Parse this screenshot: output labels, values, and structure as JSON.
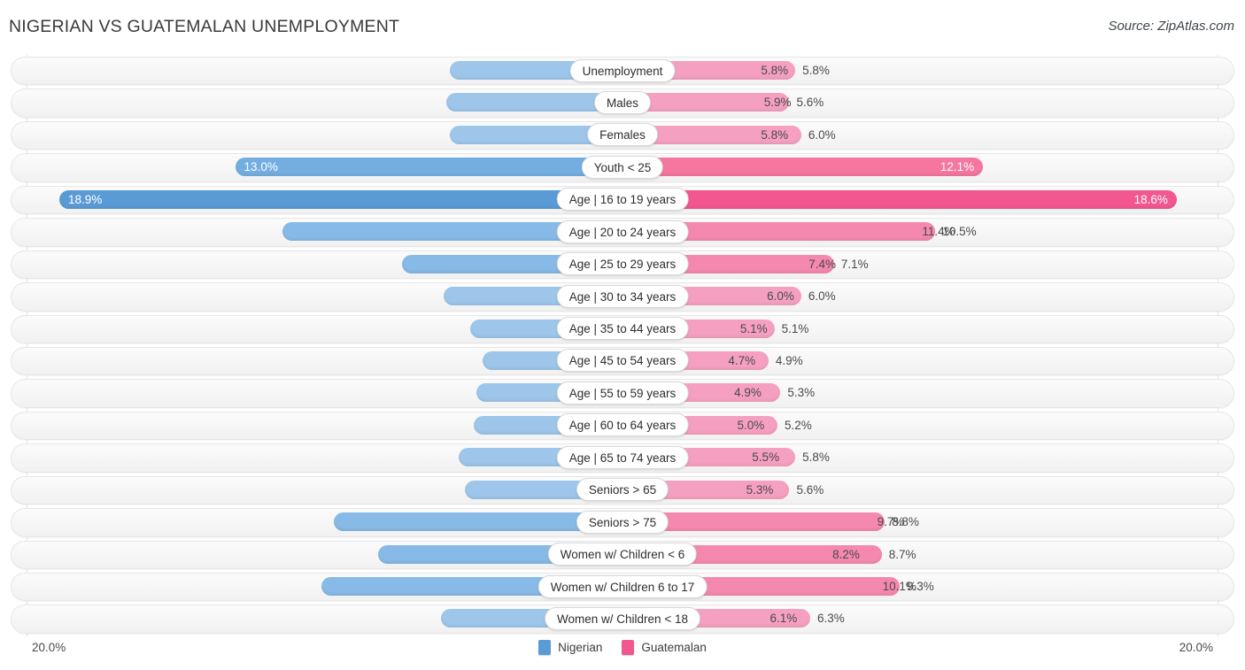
{
  "header": {
    "title": "NIGERIAN VS GUATEMALAN UNEMPLOYMENT",
    "source": "Source: ZipAtlas.com"
  },
  "footer": {
    "axis_min_label": "20.0%",
    "axis_max_label": "20.0%",
    "legend": [
      {
        "label": "Nigerian",
        "color": "#5b9bd5"
      },
      {
        "label": "Guatemalan",
        "color": "#f2578f"
      }
    ]
  },
  "colors": {
    "nigerian_light": "#9dc6ea",
    "nigerian_mid": "#87bae6",
    "nigerian_strong": "#74aee0",
    "nigerian_max": "#5b9bd5",
    "guatemalan_light": "#f5a0c0",
    "guatemalan_mid": "#f588ae",
    "guatemalan_strong": "#f5769f",
    "guatemalan_max": "#f2578f",
    "track": "#f6f6f6",
    "gridline": "#e2e2e2"
  },
  "chart_data": {
    "type": "bar",
    "subtype": "diverging-bidirectional",
    "title": "NIGERIAN VS GUATEMALAN UNEMPLOYMENT",
    "xlabel": "",
    "ylabel": "",
    "axis_max": 20.0,
    "axis_unit": "%",
    "grid": true,
    "legend_position": "bottom-center",
    "categories": [
      "Unemployment",
      "Males",
      "Females",
      "Youth < 25",
      "Age | 16 to 19 years",
      "Age | 20 to 24 years",
      "Age | 25 to 29 years",
      "Age | 30 to 34 years",
      "Age | 35 to 44 years",
      "Age | 45 to 54 years",
      "Age | 55 to 59 years",
      "Age | 60 to 64 years",
      "Age | 65 to 74 years",
      "Seniors > 65",
      "Seniors > 75",
      "Women w/ Children < 6",
      "Women w/ Children 6 to 17",
      "Women w/ Children < 18"
    ],
    "series": [
      {
        "name": "Nigerian",
        "side": "left",
        "color": "#9dc6ea",
        "values": [
          5.8,
          5.9,
          5.8,
          13.0,
          18.9,
          11.4,
          7.4,
          6.0,
          5.1,
          4.7,
          4.9,
          5.0,
          5.5,
          5.3,
          9.7,
          8.2,
          10.1,
          6.1
        ],
        "labels": [
          "5.8%",
          "5.9%",
          "5.8%",
          "13.0%",
          "18.9%",
          "11.4%",
          "7.4%",
          "6.0%",
          "5.1%",
          "4.7%",
          "4.9%",
          "5.0%",
          "5.5%",
          "5.3%",
          "9.7%",
          "8.2%",
          "10.1%",
          "6.1%"
        ]
      },
      {
        "name": "Guatemalan",
        "side": "right",
        "color": "#f5a0c0",
        "values": [
          5.8,
          5.6,
          6.0,
          12.1,
          18.6,
          10.5,
          7.1,
          6.0,
          5.1,
          4.9,
          5.3,
          5.2,
          5.8,
          5.6,
          8.8,
          8.7,
          9.3,
          6.3
        ],
        "labels": [
          "5.8%",
          "5.6%",
          "6.0%",
          "12.1%",
          "18.6%",
          "10.5%",
          "7.1%",
          "6.0%",
          "5.1%",
          "4.9%",
          "5.3%",
          "5.2%",
          "5.8%",
          "5.6%",
          "8.8%",
          "8.7%",
          "9.3%",
          "6.3%"
        ]
      }
    ],
    "rows": [
      {
        "label": "Unemployment",
        "left": 5.8,
        "right": 5.8,
        "left_label": "5.8%",
        "right_label": "5.8%",
        "emphasis": "none",
        "label_inside": false
      },
      {
        "label": "Males",
        "left": 5.9,
        "right": 5.6,
        "left_label": "5.9%",
        "right_label": "5.6%",
        "emphasis": "none",
        "label_inside": false
      },
      {
        "label": "Females",
        "left": 5.8,
        "right": 6.0,
        "left_label": "5.8%",
        "right_label": "6.0%",
        "emphasis": "none",
        "label_inside": false
      },
      {
        "label": "Youth < 25",
        "left": 13.0,
        "right": 12.1,
        "left_label": "13.0%",
        "right_label": "12.1%",
        "emphasis": "strong",
        "label_inside": true
      },
      {
        "label": "Age | 16 to 19 years",
        "left": 18.9,
        "right": 18.6,
        "left_label": "18.9%",
        "right_label": "18.6%",
        "emphasis": "max",
        "label_inside": true
      },
      {
        "label": "Age | 20 to 24 years",
        "left": 11.4,
        "right": 10.5,
        "left_label": "11.4%",
        "right_label": "10.5%",
        "emphasis": "mid",
        "label_inside": false
      },
      {
        "label": "Age | 25 to 29 years",
        "left": 7.4,
        "right": 7.1,
        "left_label": "7.4%",
        "right_label": "7.1%",
        "emphasis": "mid",
        "label_inside": false
      },
      {
        "label": "Age | 30 to 34 years",
        "left": 6.0,
        "right": 6.0,
        "left_label": "6.0%",
        "right_label": "6.0%",
        "emphasis": "none",
        "label_inside": false
      },
      {
        "label": "Age | 35 to 44 years",
        "left": 5.1,
        "right": 5.1,
        "left_label": "5.1%",
        "right_label": "5.1%",
        "emphasis": "none",
        "label_inside": false
      },
      {
        "label": "Age | 45 to 54 years",
        "left": 4.7,
        "right": 4.9,
        "left_label": "4.7%",
        "right_label": "4.9%",
        "emphasis": "none",
        "label_inside": false
      },
      {
        "label": "Age | 55 to 59 years",
        "left": 4.9,
        "right": 5.3,
        "left_label": "4.9%",
        "right_label": "5.3%",
        "emphasis": "none",
        "label_inside": false
      },
      {
        "label": "Age | 60 to 64 years",
        "left": 5.0,
        "right": 5.2,
        "left_label": "5.0%",
        "right_label": "5.2%",
        "emphasis": "none",
        "label_inside": false
      },
      {
        "label": "Age | 65 to 74 years",
        "left": 5.5,
        "right": 5.8,
        "left_label": "5.5%",
        "right_label": "5.8%",
        "emphasis": "none",
        "label_inside": false
      },
      {
        "label": "Seniors > 65",
        "left": 5.3,
        "right": 5.6,
        "left_label": "5.3%",
        "right_label": "5.6%",
        "emphasis": "none",
        "label_inside": false
      },
      {
        "label": "Seniors > 75",
        "left": 9.7,
        "right": 8.8,
        "left_label": "9.7%",
        "right_label": "8.8%",
        "emphasis": "mid",
        "label_inside": false
      },
      {
        "label": "Women w/ Children < 6",
        "left": 8.2,
        "right": 8.7,
        "left_label": "8.2%",
        "right_label": "8.7%",
        "emphasis": "mid",
        "label_inside": false
      },
      {
        "label": "Women w/ Children 6 to 17",
        "left": 10.1,
        "right": 9.3,
        "left_label": "10.1%",
        "right_label": "9.3%",
        "emphasis": "mid",
        "label_inside": false
      },
      {
        "label": "Women w/ Children < 18",
        "left": 6.1,
        "right": 6.3,
        "left_label": "6.1%",
        "right_label": "6.3%",
        "emphasis": "none",
        "label_inside": false
      }
    ]
  }
}
